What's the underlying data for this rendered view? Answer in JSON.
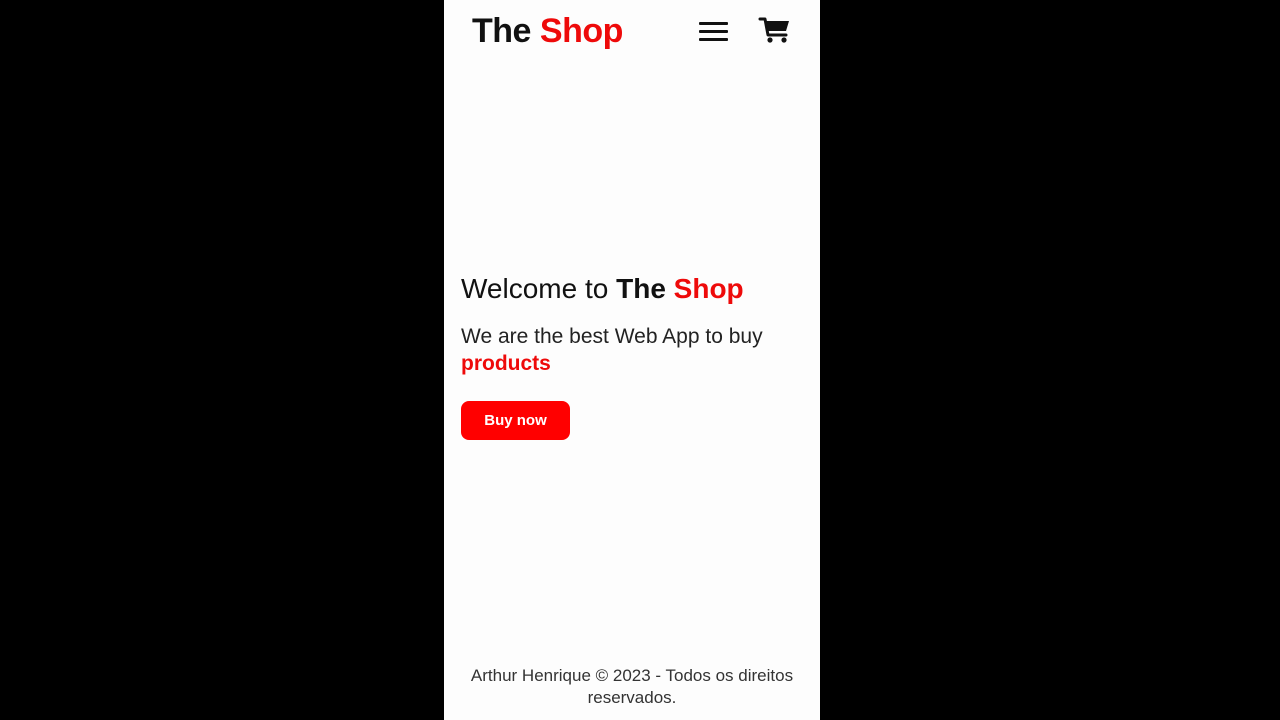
{
  "header": {
    "logo_part1": "The",
    "logo_part2": "Shop",
    "menu_icon": "hamburger-menu-icon",
    "cart_icon": "shopping-cart-icon"
  },
  "hero": {
    "welcome_prefix": "Welcome to",
    "brand_part1": "The",
    "brand_part2": "Shop",
    "tagline": "We are the best Web App to buy",
    "tagline_highlight": "products",
    "button_label": "Buy now"
  },
  "footer": {
    "text": "Arthur Henrique © 2023 - Todos os direitos reservados."
  },
  "colors": {
    "background": "#000000",
    "page": "#fdfdfd",
    "accent": "#ee0a0a",
    "button": "#ff0000",
    "text": "#111111"
  }
}
